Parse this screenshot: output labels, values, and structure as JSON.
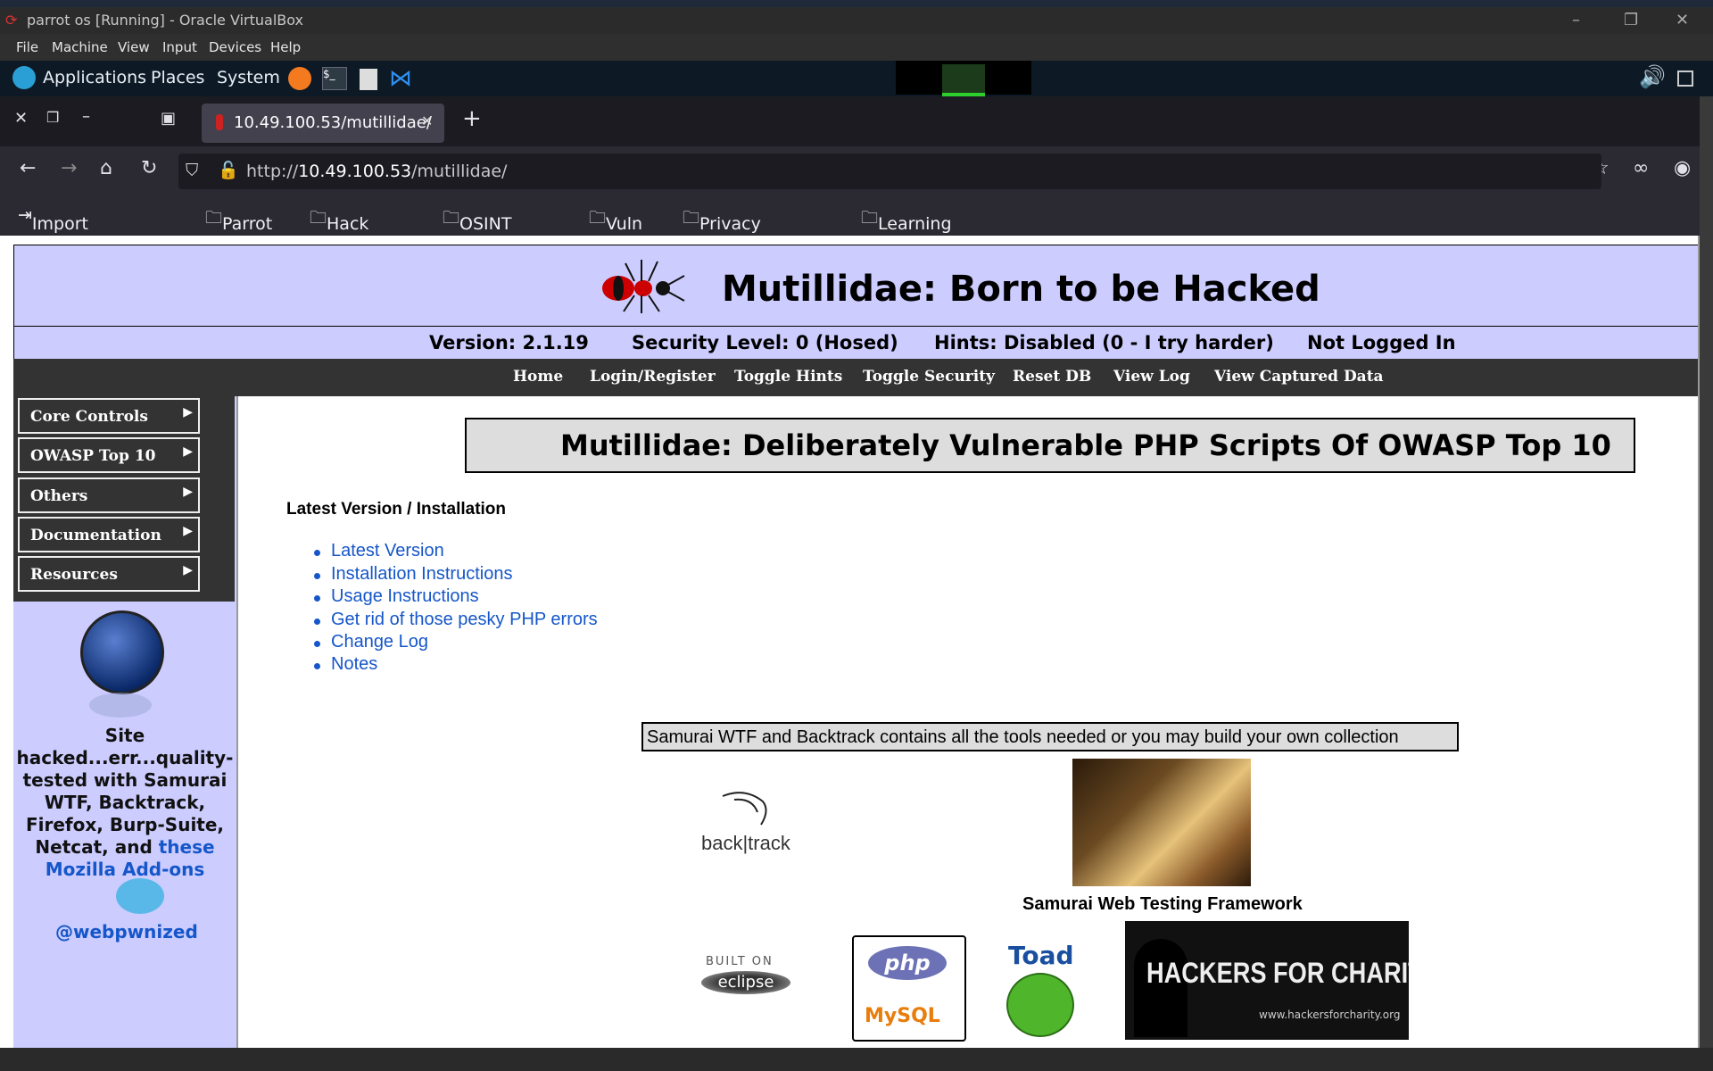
{
  "window": {
    "title": "parrot os [Running] - Oracle VirtualBox",
    "menu": [
      "File",
      "Machine",
      "View",
      "Input",
      "Devices",
      "Help"
    ]
  },
  "panel": {
    "items": [
      "Applications",
      "Places",
      "System"
    ]
  },
  "browser": {
    "tab_title": "10.49.100.53/mutillidae/",
    "url_prefix": "http://",
    "url_host": "10.49.100.53",
    "url_path": "/mutillidae/",
    "bookmarks": [
      "Import bookmarks...",
      "Parrot OS",
      "Hack The Box",
      "OSINT Services",
      "Vuln DB",
      "Privacy and Security",
      "Learning Resources"
    ]
  },
  "page": {
    "header_title": "Mutillidae: Born to be Hacked",
    "status": {
      "version": "Version: 2.1.19",
      "security": "Security Level: 0 (Hosed)",
      "hints": "Hints: Disabled (0 - I try harder)",
      "login": "Not Logged In"
    },
    "topnav": [
      "Home",
      "Login/Register",
      "Toggle Hints",
      "Toggle Security",
      "Reset DB",
      "View Log",
      "View Captured Data"
    ],
    "side_menu": [
      "Core Controls",
      "OWASP Top 10",
      "Others",
      "Documentation",
      "Resources"
    ],
    "side_text": "Site hacked...err...quality-tested with Samurai WTF, Backtrack, Firefox, Burp-Suite, Netcat, and",
    "side_link": "these Mozilla Add-ons",
    "twitter": "@webpwnized",
    "main_title": "Mutillidae: Deliberately Vulnerable PHP Scripts Of OWASP Top 10",
    "section_heading": "Latest Version / Installation",
    "links": [
      "Latest Version",
      "Installation Instructions",
      "Usage Instructions",
      "Get rid of those pesky PHP errors",
      "Change Log",
      "Notes"
    ],
    "samurai_box": "Samurai WTF and Backtrack contains all the tools needed or you may build your own collection",
    "samurai_caption": "Samurai Web Testing Framework",
    "logos": {
      "backtrack": "back|track",
      "eclipse_top": "BUILT ON",
      "eclipse": "eclipse",
      "php": "php",
      "mysql": "MySQL",
      "toad": "Toad",
      "hfc": "HACKERS FOR CHARITY",
      "hfc_url": "www.hackersforcharity.org"
    }
  },
  "colors": {
    "header_bg": "#ccccff",
    "nav_bg": "#333333",
    "link": "#1556c9"
  }
}
